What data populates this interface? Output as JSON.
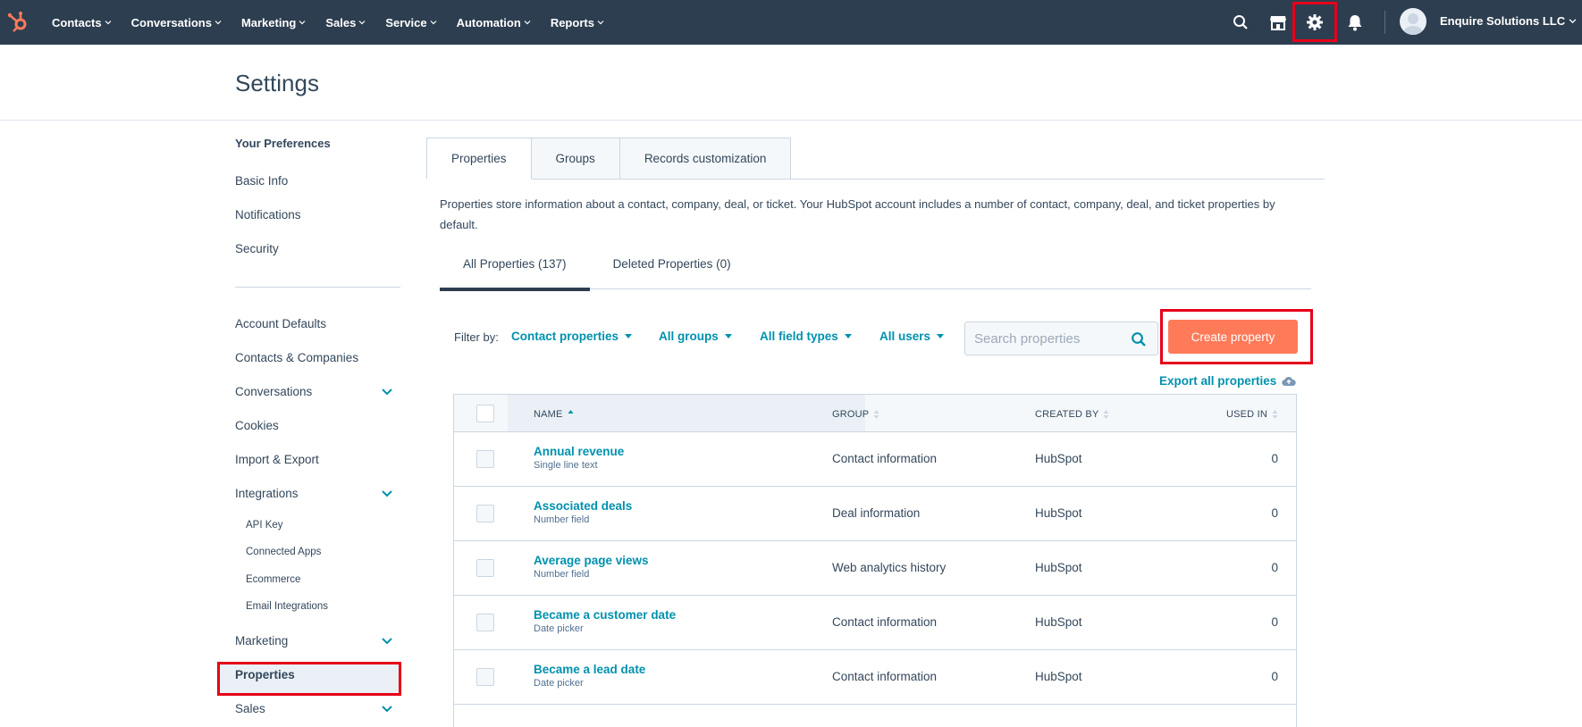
{
  "nav": {
    "menu": [
      {
        "label": "Contacts",
        "name": "nav-contacts"
      },
      {
        "label": "Conversations",
        "name": "nav-conversations"
      },
      {
        "label": "Marketing",
        "name": "nav-marketing"
      },
      {
        "label": "Sales",
        "name": "nav-sales"
      },
      {
        "label": "Service",
        "name": "nav-service"
      },
      {
        "label": "Automation",
        "name": "nav-automation"
      },
      {
        "label": "Reports",
        "name": "nav-reports"
      }
    ],
    "account": "Enquire Solutions LLC"
  },
  "header": {
    "title": "Settings"
  },
  "sidebar": {
    "preferences_heading": "Your Preferences",
    "preferences": [
      "Basic Info",
      "Notifications",
      "Security"
    ],
    "account_items": [
      {
        "label": "Account Defaults",
        "expandable": false
      },
      {
        "label": "Contacts & Companies",
        "expandable": false
      },
      {
        "label": "Conversations",
        "expandable": true
      },
      {
        "label": "Cookies",
        "expandable": false
      },
      {
        "label": "Import & Export",
        "expandable": false
      },
      {
        "label": "Integrations",
        "expandable": true
      }
    ],
    "integrations_sub": [
      "API Key",
      "Connected Apps",
      "Ecommerce",
      "Email Integrations"
    ],
    "marketing": "Marketing",
    "properties": "Properties",
    "sales": "Sales"
  },
  "tabs": [
    "Properties",
    "Groups",
    "Records customization"
  ],
  "description": "Properties store information about a contact, company, deal, or ticket. Your HubSpot account includes a number of contact, company, deal, and ticket properties by default.",
  "subtabs": [
    "All Properties (137)",
    "Deleted Properties (0)"
  ],
  "filters": {
    "label": "Filter by:",
    "object": "Contact properties",
    "groups": "All groups",
    "field_types": "All field types",
    "users": "All users"
  },
  "search": {
    "placeholder": "Search properties",
    "value": ""
  },
  "create_button": "Create property",
  "export_link": "Export all properties",
  "table": {
    "columns": {
      "name": "NAME",
      "group": "GROUP",
      "created_by": "CREATED BY",
      "used_in": "USED IN"
    },
    "sorted_by": "NAME",
    "rows": [
      {
        "name": "Annual revenue",
        "type": "Single line text",
        "group": "Contact information",
        "created_by": "HubSpot",
        "used_in": "0"
      },
      {
        "name": "Associated deals",
        "type": "Number field",
        "group": "Deal information",
        "created_by": "HubSpot",
        "used_in": "0"
      },
      {
        "name": "Average page views",
        "type": "Number field",
        "group": "Web analytics history",
        "created_by": "HubSpot",
        "used_in": "0"
      },
      {
        "name": "Became a customer date",
        "type": "Date picker",
        "group": "Contact information",
        "created_by": "HubSpot",
        "used_in": "0"
      },
      {
        "name": "Became a lead date",
        "type": "Date picker",
        "group": "Contact information",
        "created_by": "HubSpot",
        "used_in": "0"
      }
    ]
  },
  "colors": {
    "nav_bg": "#2d3e50",
    "link": "#0091ae",
    "primary_button": "#ff7a59",
    "highlight_box": "#e60019"
  }
}
